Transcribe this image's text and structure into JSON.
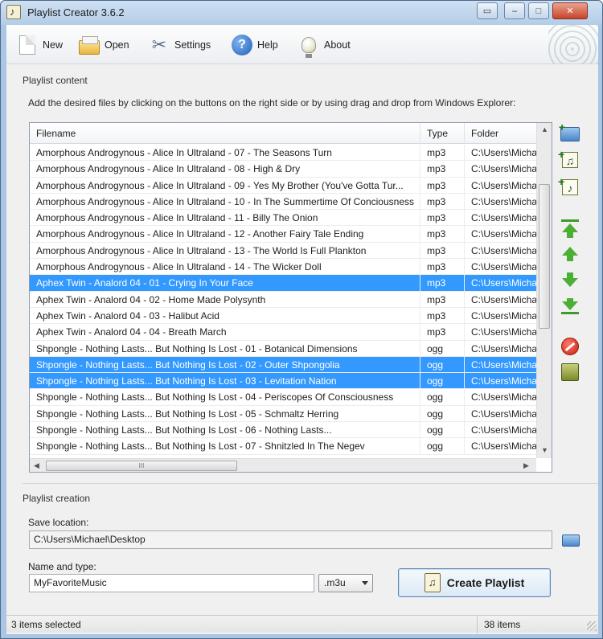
{
  "window": {
    "title": "Playlist Creator 3.6.2"
  },
  "toolbar": {
    "new_label": "New",
    "open_label": "Open",
    "settings_label": "Settings",
    "help_label": "Help",
    "about_label": "About"
  },
  "content": {
    "group_title": "Playlist content",
    "instructions": "Add the desired files by clicking on the buttons on the right side or by using drag and drop from Windows Explorer:",
    "columns": [
      "Filename",
      "Type",
      "Folder"
    ],
    "rows": [
      {
        "filename": "Amorphous Androgynous - Alice In Ultraland - 07 - The Seasons Turn",
        "type": "mp3",
        "folder": "C:\\Users\\Micha",
        "selected": false
      },
      {
        "filename": "Amorphous Androgynous - Alice In Ultraland - 08 - High & Dry",
        "type": "mp3",
        "folder": "C:\\Users\\Micha",
        "selected": false
      },
      {
        "filename": "Amorphous Androgynous - Alice In Ultraland - 09 - Yes My Brother (You've Gotta Tur...",
        "type": "mp3",
        "folder": "C:\\Users\\Micha",
        "selected": false
      },
      {
        "filename": "Amorphous Androgynous - Alice In Ultraland - 10 - In The Summertime Of Conciousness",
        "type": "mp3",
        "folder": "C:\\Users\\Micha",
        "selected": false
      },
      {
        "filename": "Amorphous Androgynous - Alice In Ultraland - 11 - Billy The Onion",
        "type": "mp3",
        "folder": "C:\\Users\\Micha",
        "selected": false
      },
      {
        "filename": "Amorphous Androgynous - Alice In Ultraland - 12 - Another Fairy Tale Ending",
        "type": "mp3",
        "folder": "C:\\Users\\Micha",
        "selected": false
      },
      {
        "filename": "Amorphous Androgynous - Alice In Ultraland - 13 - The World Is Full Plankton",
        "type": "mp3",
        "folder": "C:\\Users\\Micha",
        "selected": false
      },
      {
        "filename": "Amorphous Androgynous - Alice In Ultraland - 14 - The Wicker Doll",
        "type": "mp3",
        "folder": "C:\\Users\\Micha",
        "selected": false
      },
      {
        "filename": "Aphex Twin - Analord 04 - 01 - Crying In Your Face",
        "type": "mp3",
        "folder": "C:\\Users\\Micha",
        "selected": true
      },
      {
        "filename": "Aphex Twin - Analord 04 - 02 - Home Made Polysynth",
        "type": "mp3",
        "folder": "C:\\Users\\Micha",
        "selected": false
      },
      {
        "filename": "Aphex Twin - Analord 04 - 03 - Halibut Acid",
        "type": "mp3",
        "folder": "C:\\Users\\Micha",
        "selected": false
      },
      {
        "filename": "Aphex Twin - Analord 04 - 04 - Breath March",
        "type": "mp3",
        "folder": "C:\\Users\\Micha",
        "selected": false
      },
      {
        "filename": "Shpongle - Nothing Lasts... But Nothing Is Lost - 01 - Botanical Dimensions",
        "type": "ogg",
        "folder": "C:\\Users\\Micha",
        "selected": false
      },
      {
        "filename": "Shpongle - Nothing Lasts... But Nothing Is Lost - 02 - Outer Shpongolia",
        "type": "ogg",
        "folder": "C:\\Users\\Micha",
        "selected": true
      },
      {
        "filename": "Shpongle - Nothing Lasts... But Nothing Is Lost - 03 - Levitation Nation",
        "type": "ogg",
        "folder": "C:\\Users\\Micha",
        "selected": true
      },
      {
        "filename": "Shpongle - Nothing Lasts... But Nothing Is Lost - 04 - Periscopes Of Consciousness",
        "type": "ogg",
        "folder": "C:\\Users\\Micha",
        "selected": false
      },
      {
        "filename": "Shpongle - Nothing Lasts... But Nothing Is Lost - 05 - Schmaltz Herring",
        "type": "ogg",
        "folder": "C:\\Users\\Micha",
        "selected": false
      },
      {
        "filename": "Shpongle - Nothing Lasts... But Nothing Is Lost - 06 - Nothing Lasts...",
        "type": "ogg",
        "folder": "C:\\Users\\Micha",
        "selected": false
      },
      {
        "filename": "Shpongle - Nothing Lasts... But Nothing Is Lost - 07 - Shnitzled In The Negev",
        "type": "ogg",
        "folder": "C:\\Users\\Micha",
        "selected": false
      }
    ],
    "hscroll_grip": "III"
  },
  "creation": {
    "group_title": "Playlist creation",
    "save_location_label": "Save location:",
    "save_location_value": "C:\\Users\\Michael\\Desktop",
    "name_type_label": "Name and type:",
    "name_value": "MyFavoriteMusic",
    "type_value": ".m3u",
    "create_button_label": "Create Playlist"
  },
  "status": {
    "selected": "3 items selected",
    "total": "38 items"
  },
  "icons": {
    "selection_color": "#3399ff"
  }
}
